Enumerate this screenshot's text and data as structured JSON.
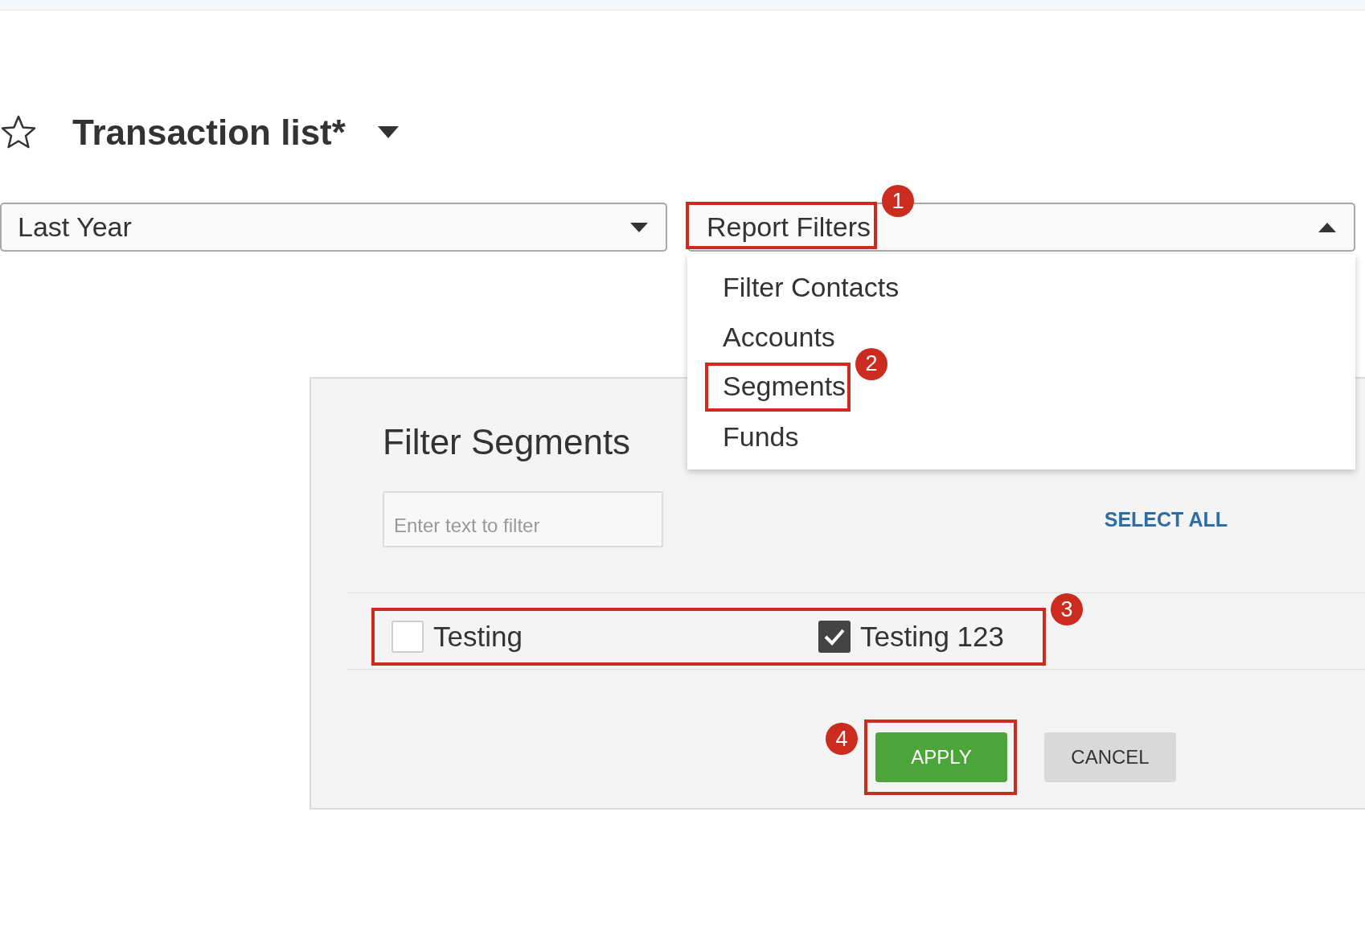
{
  "header": {
    "title": "Transaction list*",
    "favorite": false
  },
  "date_range": {
    "value": "Last Year"
  },
  "report_filters": {
    "label": "Report Filters",
    "expanded": true,
    "callout": {
      "number": "1"
    },
    "menu": [
      {
        "label": "Filter Contacts"
      },
      {
        "label": "Accounts"
      },
      {
        "label": "Segments",
        "callout": {
          "number": "2"
        }
      },
      {
        "label": "Funds"
      }
    ]
  },
  "panel": {
    "title": "Filter Segments",
    "filter_placeholder": "Enter text to filter",
    "select_all": "SELECT ALL",
    "segments_callout": {
      "number": "3"
    },
    "segments": [
      {
        "label": "Testing",
        "checked": false
      },
      {
        "label": "Testing 123",
        "checked": true
      }
    ],
    "buttons": [
      {
        "label": "APPLY",
        "kind": "primary",
        "callout": {
          "number": "4"
        }
      },
      {
        "label": "CANCEL",
        "kind": "secondary"
      }
    ]
  }
}
